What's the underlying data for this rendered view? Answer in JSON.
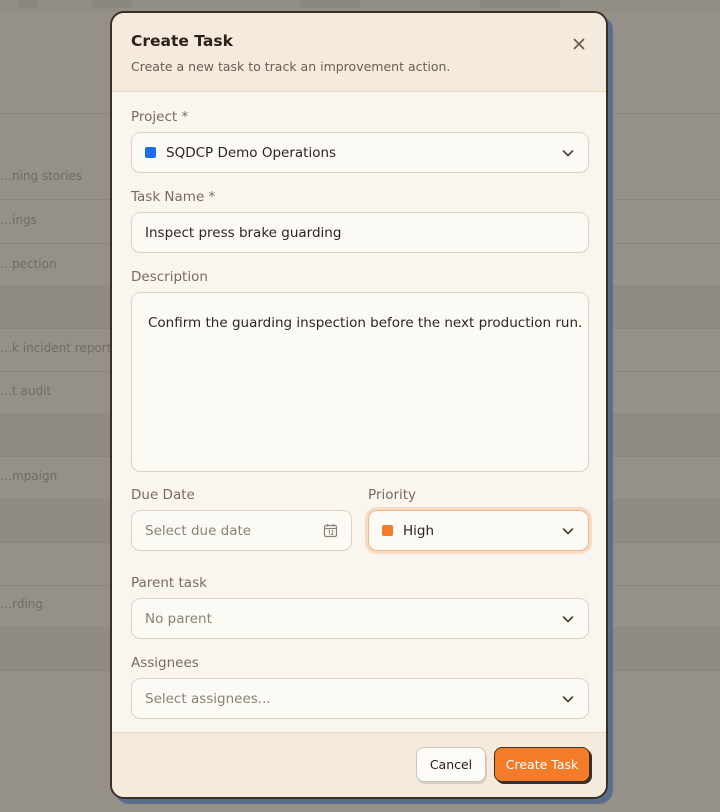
{
  "background": {
    "rows": [
      "…ning stories",
      "…ings",
      "…pection",
      "",
      "…k incident report",
      "…t audit",
      "",
      "…mpaign",
      "",
      "",
      "…rding",
      ""
    ]
  },
  "modal": {
    "title": "Create Task",
    "subtitle": "Create a new task to track an improvement action.",
    "close_icon": "close-icon",
    "project": {
      "label": "Project *",
      "value": "SQDCP Demo Operations",
      "swatch_color": "#1f6fe8"
    },
    "task_name": {
      "label": "Task Name *",
      "value": "Inspect press brake guarding"
    },
    "description": {
      "label": "Description",
      "value": "Confirm the guarding inspection before the next production run."
    },
    "due_date": {
      "label": "Due Date",
      "placeholder": "Select due date",
      "icon": "calendar-icon"
    },
    "priority": {
      "label": "Priority",
      "value": "High",
      "swatch_color": "#f47b2a"
    },
    "parent_task": {
      "label": "Parent task",
      "value": "No parent"
    },
    "assignees": {
      "label": "Assignees",
      "placeholder": "Select assignees..."
    },
    "footer": {
      "cancel_label": "Cancel",
      "create_label": "Create Task"
    }
  },
  "colors": {
    "accent": "#f47b2a",
    "border_dark": "#3a2e26",
    "shadow_blue": "#5b6f8c"
  }
}
